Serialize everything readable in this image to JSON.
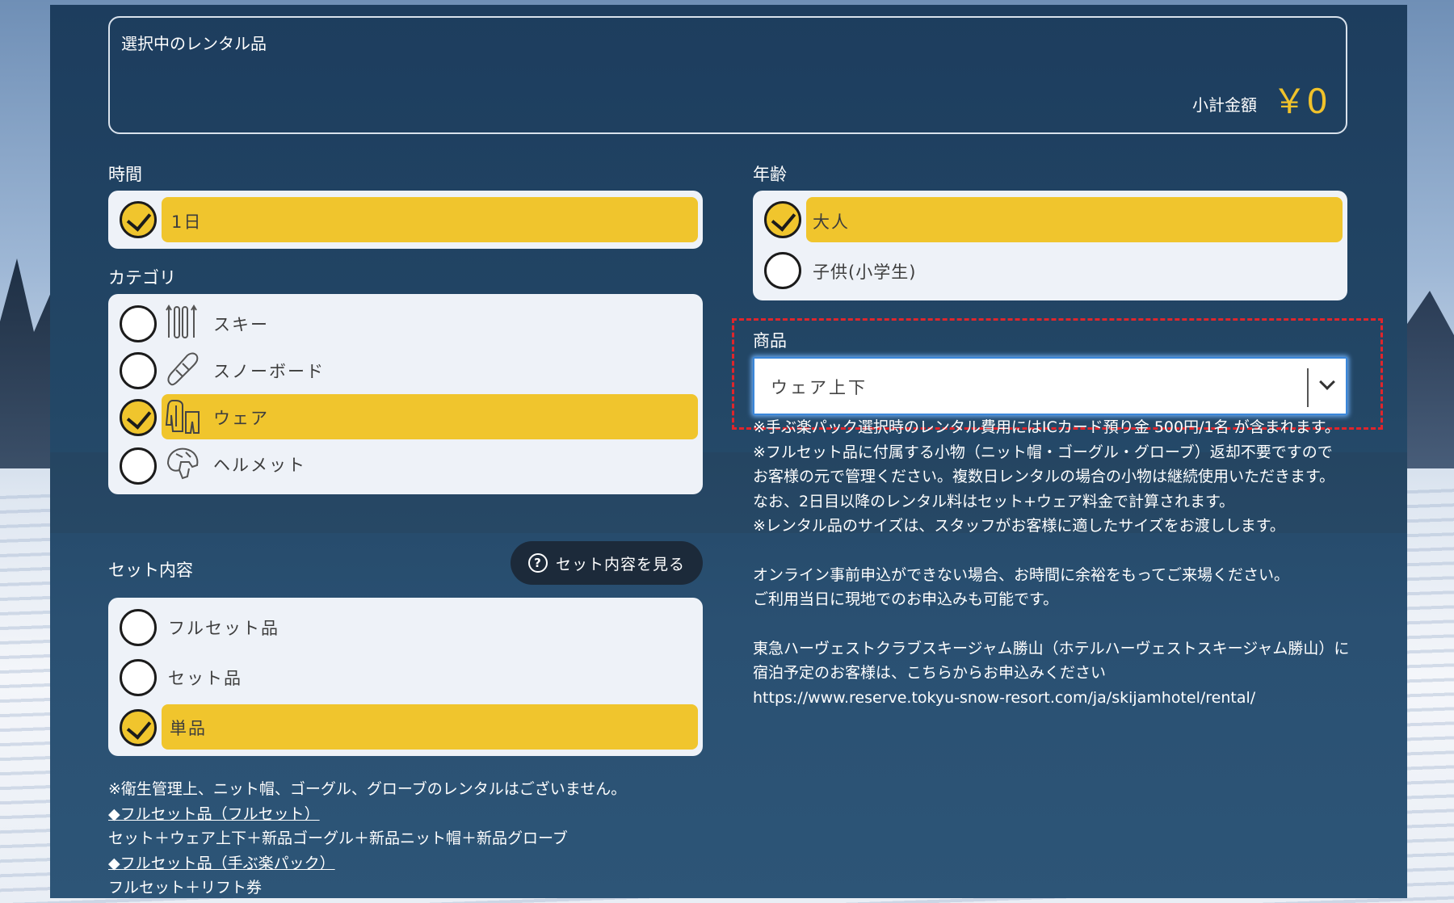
{
  "selected": {
    "title": "選択中のレンタル品",
    "subtotal_label": "小計金額",
    "subtotal_value": "￥0"
  },
  "time": {
    "label": "時間",
    "options": [
      {
        "label": "1日",
        "selected": true
      }
    ]
  },
  "category": {
    "label": "カテゴリ",
    "options": [
      {
        "label": "スキー",
        "icon": "ski-icon",
        "selected": false
      },
      {
        "label": "スノーボード",
        "icon": "snowboard-icon",
        "selected": false
      },
      {
        "label": "ウェア",
        "icon": "wear-icon",
        "selected": true
      },
      {
        "label": "ヘルメット",
        "icon": "helmet-icon",
        "selected": false
      }
    ]
  },
  "set_contents": {
    "label": "セット内容",
    "button_label": "セット内容を見る",
    "options": [
      {
        "label": "フルセット品",
        "selected": false
      },
      {
        "label": "セット品",
        "selected": false
      },
      {
        "label": "単品",
        "selected": true
      }
    ]
  },
  "age": {
    "label": "年齢",
    "options": [
      {
        "label": "大人",
        "selected": true
      },
      {
        "label": "子供(小学生)",
        "selected": false
      }
    ]
  },
  "product": {
    "label": "商品",
    "selected_value": "ウェア上下"
  },
  "notes": {
    "lines": [
      "※手ぶ楽パック選択時のレンタル費用にはICカード預り金 500円/1名 が含まれます。",
      "※フルセット品に付属する小物（ニット帽・ゴーグル・グローブ）返却不要ですので",
      "お客様の元で管理ください。複数日レンタルの場合の小物は継続使用いただきます。",
      "なお、2日目以降のレンタル料はセット+ウェア料金で計算されます。",
      "※レンタル品のサイズは、スタッフがお客様に適したサイズをお渡しします。",
      "オンライン事前申込ができない場合、お時間に余裕をもってご来場ください。",
      "ご利用当日に現地でのお申込みも可能です。",
      "東急ハーヴェストクラブスキージャム勝山（ホテルハーヴェストスキージャム勝山）に宿泊予定のお客様は、こちらからお申込みください",
      "https://www.reserve.tokyu-snow-resort.com/ja/skijamhotel/rental/"
    ]
  },
  "bottom_notes": {
    "hygiene": "※衛生管理上、ニット帽、ゴーグル、グローブのレンタルはございません。",
    "fullset_link": "◆フルセット品（フルセット）",
    "fullset_desc": "セット＋ウェア上下＋新品ゴーグル＋新品ニット帽＋新品グローブ",
    "tebura_link": "◆フルセット品（手ぶ楽パック）",
    "tebura_desc": "フルセット＋リフト券"
  }
}
